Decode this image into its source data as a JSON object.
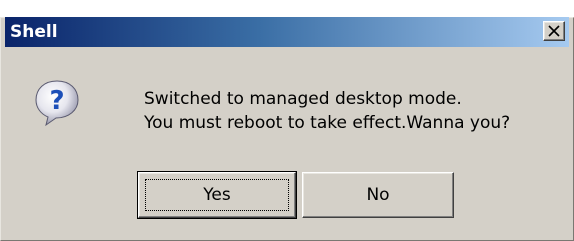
{
  "window": {
    "title": "Shell",
    "close_icon": "close-icon"
  },
  "dialog": {
    "icon": "question-icon",
    "message_line1": "Switched to managed desktop mode.",
    "message_line2": "You must reboot to take effect.Wanna you?"
  },
  "buttons": {
    "yes_label": "Yes",
    "no_label": "No"
  },
  "colors": {
    "titlebar_start": "#0a246a",
    "titlebar_end": "#a6caf0",
    "dialog_bg": "#d4d0c8",
    "icon_blue": "#1c4fb8"
  }
}
